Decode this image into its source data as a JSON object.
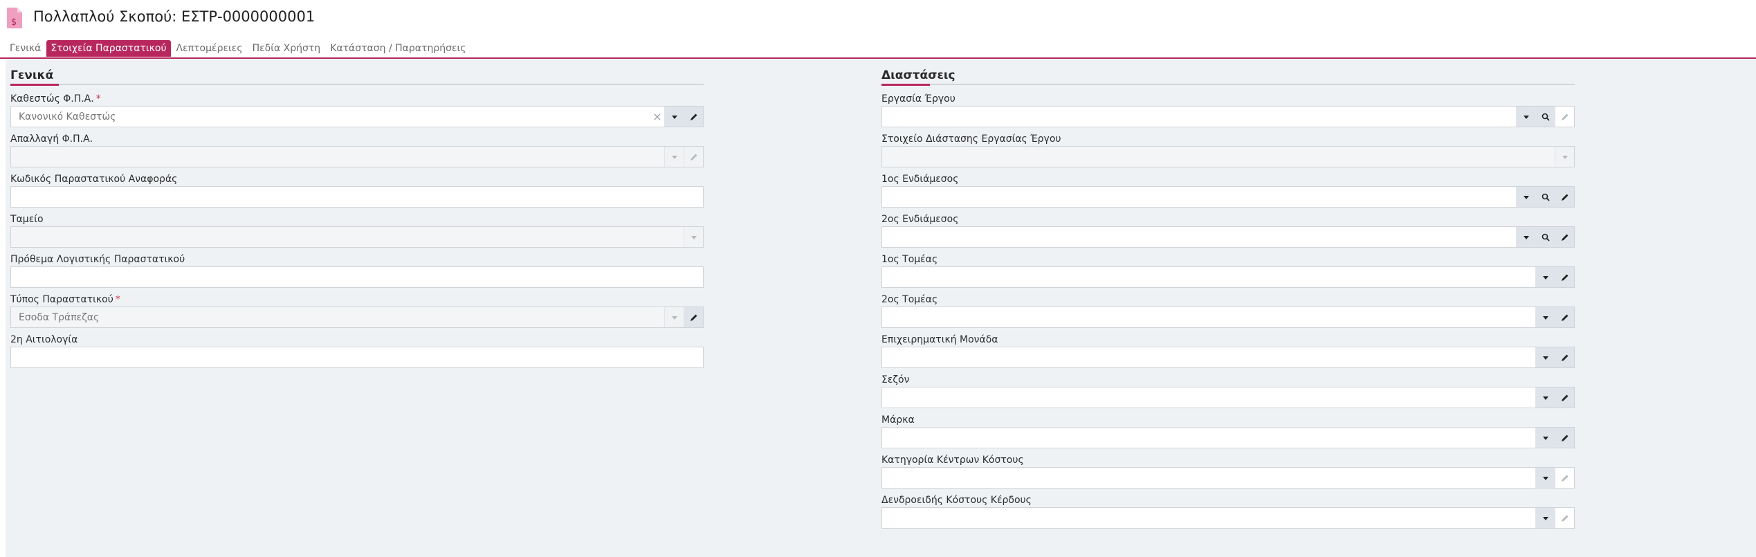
{
  "header": {
    "title": "Πολλαπλού Σκοπού: ΕΣΤΡ-0000000001",
    "icon": "invoice-dollar-icon"
  },
  "tabs": [
    {
      "label": "Γενικά",
      "active": false
    },
    {
      "label": "Στοιχεία Παραστατικού",
      "active": true
    },
    {
      "label": "Λεπτομέρειες",
      "active": false
    },
    {
      "label": "Πεδία Χρήστη",
      "active": false
    },
    {
      "label": "Κατάσταση / Παρατηρήσεις",
      "active": false
    }
  ],
  "general": {
    "title": "Γενικά",
    "fields": [
      {
        "label": "Καθεστώς Φ.Π.Α.",
        "required": true,
        "value": "Κανονικό Καθεστώς",
        "type": "combo-edit-clear",
        "disabled": false
      },
      {
        "label": "Απαλλαγή Φ.Π.Α.",
        "required": false,
        "value": "",
        "type": "combo-edit",
        "disabled": true
      },
      {
        "label": "Κωδικός Παραστατικού Αναφοράς",
        "required": false,
        "value": "",
        "type": "text",
        "disabled": false
      },
      {
        "label": "Ταμείο",
        "required": false,
        "value": "",
        "type": "combo",
        "disabled": true
      },
      {
        "label": "Πρόθεμα Λογιστικής Παραστατικού",
        "required": false,
        "value": "",
        "type": "text",
        "disabled": false
      },
      {
        "label": "Τύπος Παραστατικού",
        "required": true,
        "value": "Εσοδα Τράπεζας",
        "type": "combo-edit-active",
        "disabled": true
      },
      {
        "label": "2η Αιτιολογία",
        "required": false,
        "value": "",
        "type": "text",
        "disabled": false
      }
    ]
  },
  "dimensions": {
    "title": "Διαστάσεις",
    "fields": [
      {
        "label": "Εργασία Έργου",
        "value": "",
        "type": "combo-search-editdim",
        "disabled": false
      },
      {
        "label": "Στοιχείο Διάστασης Εργασίας Έργου",
        "value": "",
        "type": "combo",
        "disabled": true
      },
      {
        "label": "1ος Ενδιάμεσος",
        "value": "",
        "type": "combo-search-edit",
        "disabled": false
      },
      {
        "label": "2ος Ενδιάμεσος",
        "value": "",
        "type": "combo-search-edit",
        "disabled": false
      },
      {
        "label": "1ος Τομέας",
        "value": "",
        "type": "combo-edit",
        "disabled": false
      },
      {
        "label": "2ος Τομέας",
        "value": "",
        "type": "combo-edit",
        "disabled": false
      },
      {
        "label": "Επιχειρηματική Μονάδα",
        "value": "",
        "type": "combo-edit",
        "disabled": false
      },
      {
        "label": "Σεζόν",
        "value": "",
        "type": "combo-edit",
        "disabled": false
      },
      {
        "label": "Μάρκα",
        "value": "",
        "type": "combo-edit",
        "disabled": false
      },
      {
        "label": "Κατηγορία Κέντρων Κόστους",
        "value": "",
        "type": "combo-editdim",
        "disabled": false
      },
      {
        "label": "Δενδροειδής Κόστους Κέρδους",
        "value": "",
        "type": "combo-editdim",
        "disabled": false
      }
    ]
  },
  "colors": {
    "accent": "#b7275d",
    "background": "#eff2f5"
  }
}
